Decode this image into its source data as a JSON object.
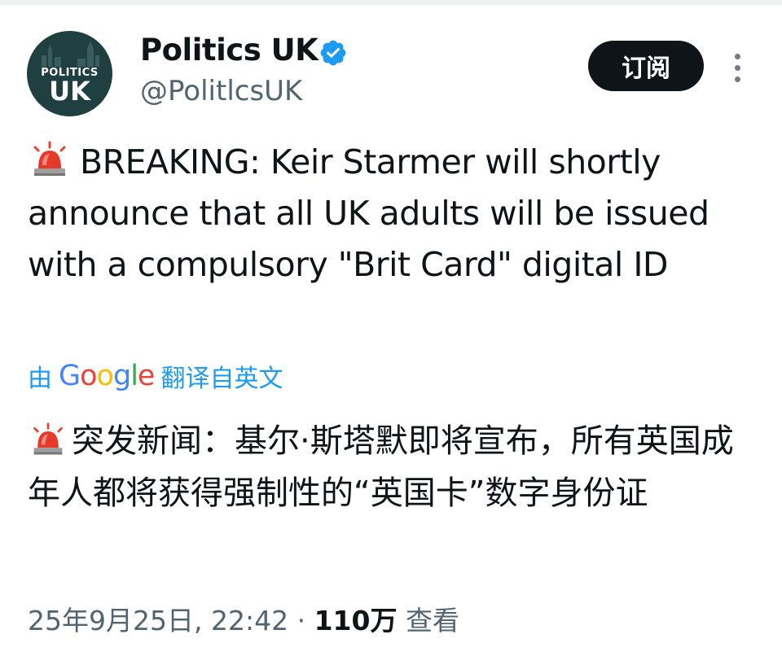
{
  "account": {
    "avatar_text_top": "POLITICS",
    "avatar_text_bottom": "UK",
    "display_name": "Politics UK",
    "handle": "@PolitlcsUK",
    "verified_icon": "verified-badge-icon"
  },
  "actions": {
    "subscribe_label": "订阅",
    "more_icon": "more-vertical-icon"
  },
  "tweet": {
    "emoji": "rotating-light-icon",
    "text": "BREAKING: Keir Starmer will shortly announce that all UK adults will be issued with a compulsory \"Brit Card\" digital ID"
  },
  "translation": {
    "prefix": "由",
    "provider": "Google",
    "suffix": "翻译自英文",
    "text": "突发新闻：基尔·斯塔默即将宣布，所有英国成年人都将获得强制性的“英国卡”数字身份证"
  },
  "meta": {
    "timestamp": "25年9月25日, 22:42",
    "separator": "·",
    "views_count": "110万",
    "views_label": "查看"
  },
  "colors": {
    "accent_link": "#1d9bf0",
    "verified": "#1d9bf0",
    "subscribe_bg": "#0f1419",
    "avatar_bg": "#1f3f40",
    "muted_text": "#536471"
  }
}
